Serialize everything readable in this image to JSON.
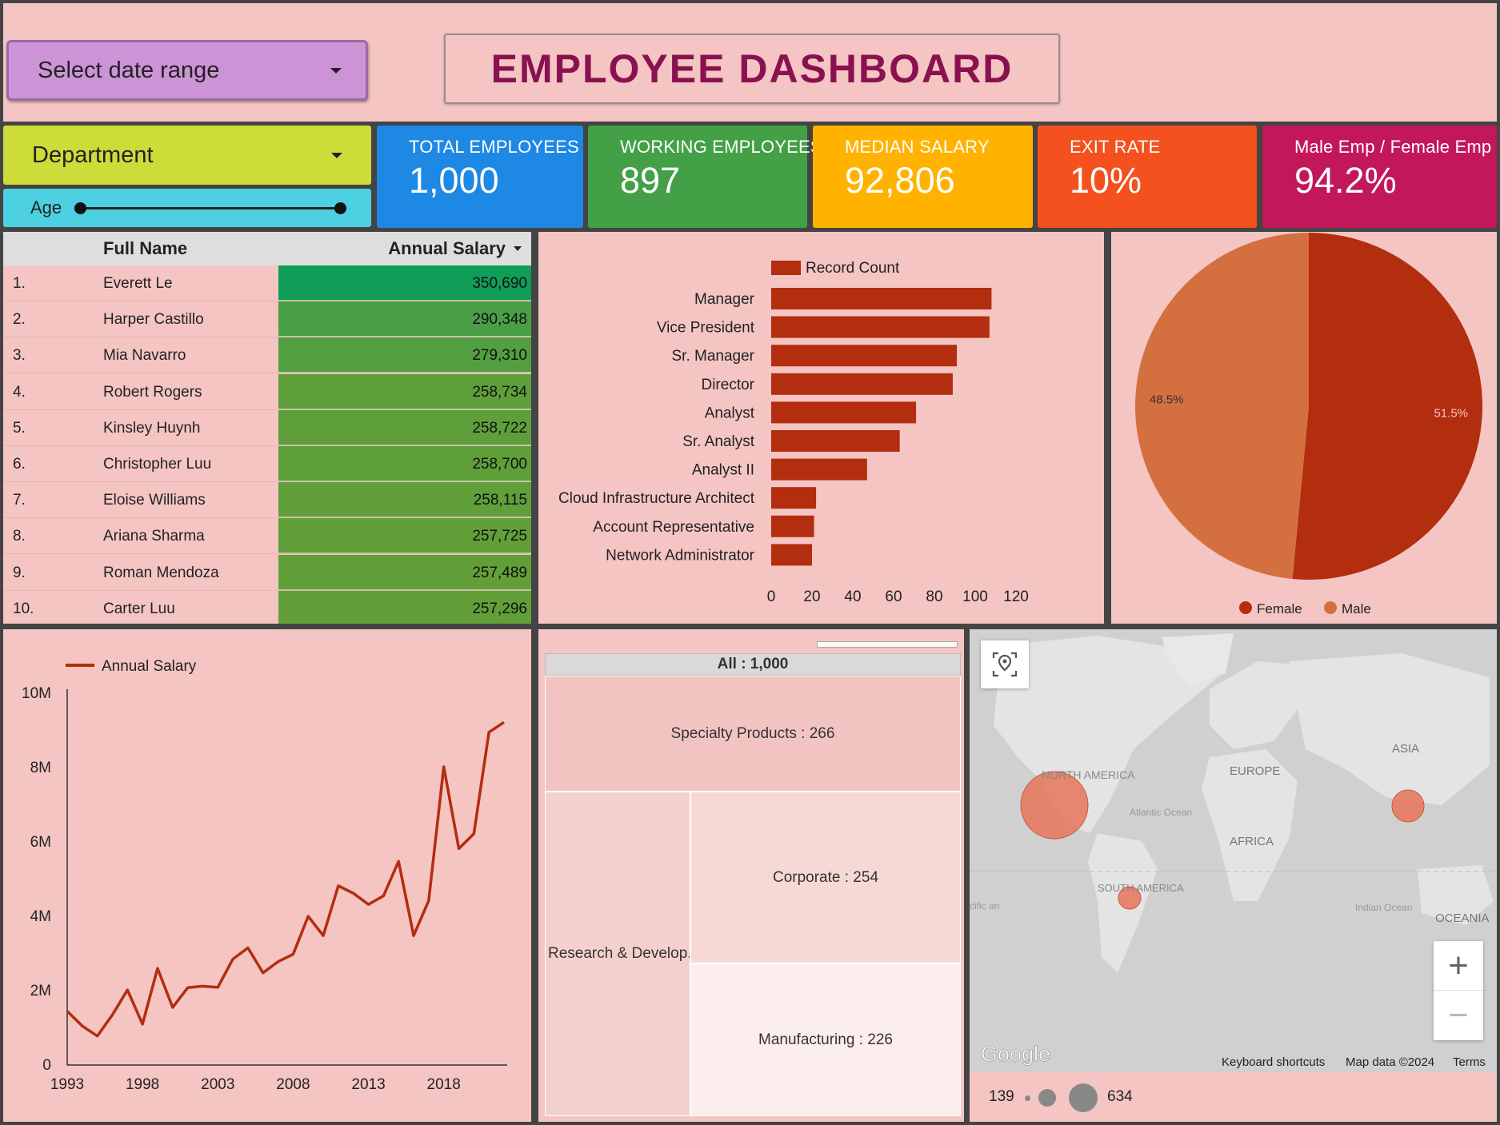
{
  "header": {
    "date_range_label": "Select date range",
    "title": "EMPLOYEE DASHBOARD"
  },
  "filters": {
    "department_label": "Department",
    "age_label": "Age"
  },
  "kpis": [
    {
      "label": "TOTAL EMPLOYEES",
      "value": "1,000",
      "color": "#1e88e5"
    },
    {
      "label": "WORKING EMPLOYEES",
      "value": "897",
      "color": "#43a047"
    },
    {
      "label": "MEDIAN SALARY",
      "value": "92,806",
      "color": "#ffb300"
    },
    {
      "label": "EXIT RATE",
      "value": "10%",
      "color": "#f4511e"
    },
    {
      "label": "Male Emp / Female Emp",
      "value": "94.2%",
      "color": "#c2185b"
    }
  ],
  "table": {
    "col_name": "Full Name",
    "col_salary": "Annual Salary",
    "rows": [
      {
        "idx": "1.",
        "name": "Everett Le",
        "salary": "350,690",
        "color": "#0f9d58"
      },
      {
        "idx": "2.",
        "name": "Harper Castillo",
        "salary": "290,348",
        "color": "#4a9e45"
      },
      {
        "idx": "3.",
        "name": "Mia Navarro",
        "salary": "279,310",
        "color": "#529f41"
      },
      {
        "idx": "4.",
        "name": "Robert Rogers",
        "salary": "258,734",
        "color": "#5e9f3b"
      },
      {
        "idx": "5.",
        "name": "Kinsley Huynh",
        "salary": "258,722",
        "color": "#5e9f3b"
      },
      {
        "idx": "6.",
        "name": "Christopher Luu",
        "salary": "258,700",
        "color": "#5f9f3a"
      },
      {
        "idx": "7.",
        "name": "Eloise Williams",
        "salary": "258,115",
        "color": "#609f3a"
      },
      {
        "idx": "8.",
        "name": "Ariana Sharma",
        "salary": "257,725",
        "color": "#619f39"
      },
      {
        "idx": "9.",
        "name": "Roman Mendoza",
        "salary": "257,489",
        "color": "#629f39"
      },
      {
        "idx": "10.",
        "name": "Carter Luu",
        "salary": "257,296",
        "color": "#639f38"
      }
    ]
  },
  "chart_data": [
    {
      "type": "bar",
      "orientation": "horizontal",
      "legend": "Record Count",
      "color": "#b32d0f",
      "categories": [
        "Manager",
        "Vice President",
        "Sr. Manager",
        "Director",
        "Analyst",
        "Sr. Analyst",
        "Analyst II",
        "Cloud Infrastructure Architect",
        "Account Representative",
        "Network Administrator"
      ],
      "values": [
        108,
        107,
        91,
        89,
        71,
        63,
        47,
        22,
        21,
        20
      ],
      "xticks": [
        "0",
        "20",
        "40",
        "60",
        "80",
        "100",
        "120"
      ],
      "xlim": [
        0,
        120
      ]
    },
    {
      "type": "pie",
      "labels": [
        "Female",
        "Male"
      ],
      "values": [
        51.5,
        48.5
      ],
      "value_labels": [
        "51.5%",
        "48.5%"
      ],
      "colors": [
        "#b32d0f",
        "#d4703f"
      ],
      "legend_position": "bottom"
    },
    {
      "type": "line",
      "legend": "Annual Salary",
      "color": "#b32d0f",
      "x": [
        1993,
        1994,
        1995,
        1996,
        1997,
        1998,
        1999,
        2000,
        2001,
        2002,
        2003,
        2004,
        2005,
        2006,
        2007,
        2008,
        2009,
        2010,
        2011,
        2012,
        2013,
        2014,
        2015,
        2016,
        2017,
        2018,
        2019,
        2020,
        2021,
        2022
      ],
      "y": [
        1.45,
        1.05,
        0.78,
        1.35,
        2.02,
        1.1,
        2.6,
        1.55,
        2.08,
        2.12,
        2.09,
        2.85,
        3.15,
        2.48,
        2.78,
        2.98,
        4.0,
        3.48,
        4.82,
        4.62,
        4.32,
        4.55,
        5.48,
        3.48,
        4.42,
        8.02,
        5.82,
        6.22,
        8.95,
        9.22
      ],
      "y_unit": "M",
      "xticks": [
        "1993",
        "1998",
        "2003",
        "2008",
        "2013",
        "2018"
      ],
      "yticks": [
        "0",
        "2M",
        "4M",
        "6M",
        "8M",
        "10M"
      ],
      "ylim": [
        0,
        10
      ]
    },
    {
      "type": "treemap",
      "root": "All : 1,000",
      "nodes": [
        {
          "label": "Specialty Products : 266",
          "value": 266,
          "color": "#f2c4c1"
        },
        {
          "label": "Research & Develop...",
          "value": 254,
          "color": "#f4d0cd"
        },
        {
          "label": "Corporate : 254",
          "value": 254,
          "color": "#f6d8d5"
        },
        {
          "label": "Manufacturing : 226",
          "value": 226,
          "color": "#fbeeec"
        }
      ]
    }
  ],
  "map": {
    "labels": {
      "north_america": "NORTH AMERICA",
      "south_america": "SOUTH AMERICA",
      "europe": "EUROPE",
      "africa": "AFRICA",
      "asia": "ASIA",
      "oceania": "OCEANIA",
      "atlantic": "Atlantic Ocean",
      "indian": "Indian Ocean",
      "pacific": "cific an"
    },
    "bubble_color": "#e8765a",
    "google": "Google",
    "shortcuts": "Keyboard shortcuts",
    "map_data": "Map data ©2024",
    "terms": "Terms",
    "zoom_in": "+",
    "zoom_out": "−",
    "legend_min": "139",
    "legend_max": "634"
  }
}
